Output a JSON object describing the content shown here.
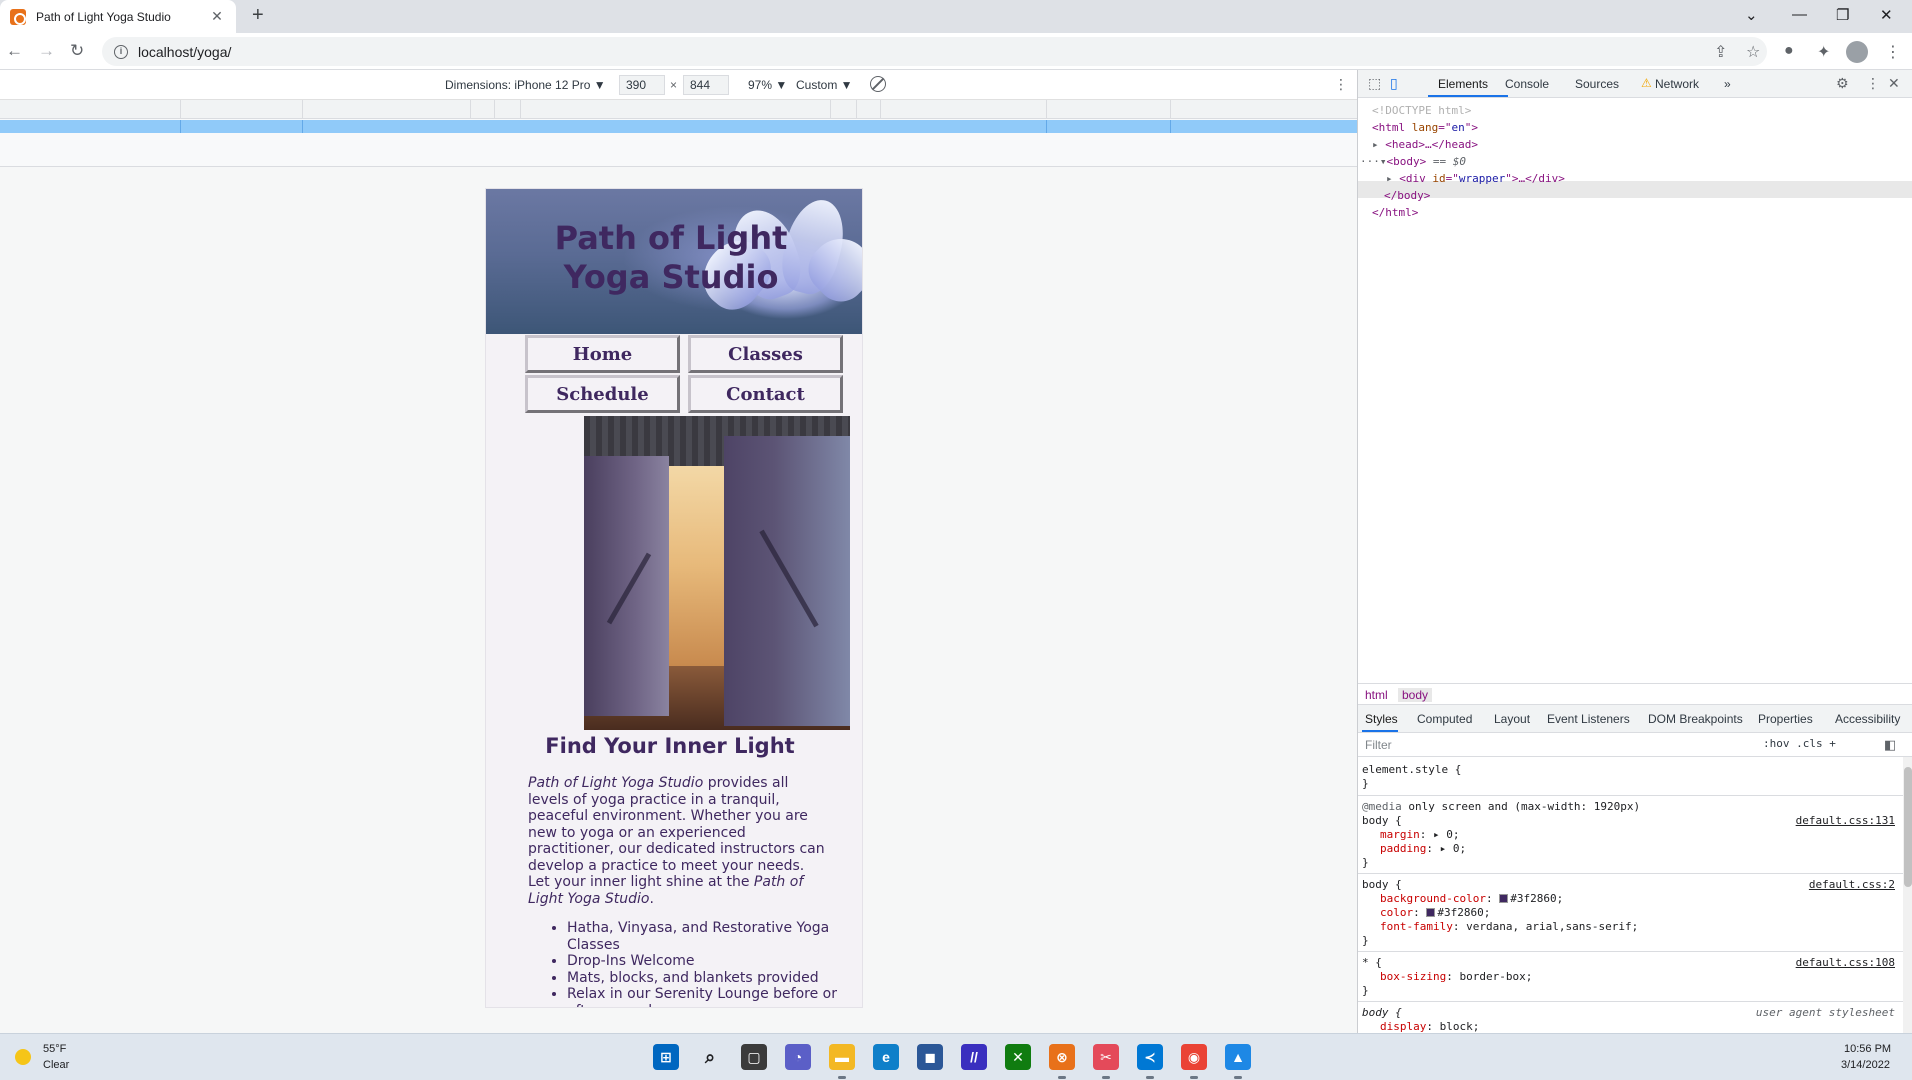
{
  "browser": {
    "tab_title": "Path of Light Yoga Studio",
    "url": "localhost/yoga/",
    "close_glyph": "✕",
    "new_tab_glyph": "+"
  },
  "device_toolbar": {
    "dimensions_label": "Dimensions: iPhone 12 Pro ▼",
    "width": "390",
    "height": "844",
    "times": "×",
    "zoom": "97% ▼",
    "throttle": "Custom ▼"
  },
  "site": {
    "title_line1": "Path of Light",
    "title_line2": "Yoga Studio",
    "nav": [
      "Home",
      "Classes",
      "Schedule",
      "Contact"
    ],
    "heading": "Find Your Inner Light",
    "intro_em1": "Path of Light Yoga Studio",
    "intro_text": " provides all levels of yoga practice in a tranquil, peaceful environment. Whether you are new to yoga or an experienced practitioner, our dedicated instructors can develop a practice to meet your needs. Let your inner light shine at the ",
    "intro_em2": "Path of Light Yoga Studio",
    "intro_end": ".",
    "features": [
      "Hatha, Vinyasa, and Restorative Yoga Classes",
      "Drop-Ins Welcome",
      "Mats, blocks, and blankets provided",
      "Relax in our Serenity Lounge before or after your class"
    ]
  },
  "devtools": {
    "tabs": [
      "Elements",
      "Console",
      "Sources",
      "Network"
    ],
    "more": "»",
    "dom": {
      "doctype": "<!DOCTYPE html>",
      "html_open_tag": "<html ",
      "html_attr_name": "lang",
      "html_attr_eq": "=\"",
      "html_attr_value": "en",
      "html_attr_close": "\">",
      "head": "<head>…</head>",
      "body_open": "<body>",
      "body_marker": " == $0",
      "div_open": "<div ",
      "div_attr_name": "id",
      "div_attr_value": "wrapper",
      "div_rest": "\">…</div>",
      "body_close": "</body>",
      "html_close": "</html>",
      "dots": "···"
    },
    "crumbs": [
      "html",
      "body"
    ],
    "style_tabs": [
      "Styles",
      "Computed",
      "Layout",
      "Event Listeners",
      "DOM Breakpoints",
      "Properties",
      "Accessibility"
    ],
    "filter_placeholder": "Filter",
    "filter_tools": ":hov  .cls  +",
    "css": {
      "element_style": "element.style {",
      "close_brace": "}",
      "media_at": "@media",
      "media_query": " only screen and (max-width: 1920px)",
      "body_sel": "body {",
      "src1": "default.css:131",
      "margin_prop": "margin",
      "margin_val": ": ▸ 0;",
      "padding_prop": "padding",
      "padding_val": ": ▸ 0;",
      "src2": "default.css:2",
      "bg_prop": "background-color",
      "bg_val": "#3f2860;",
      "color_prop": "color",
      "color_val": "#3f2860;",
      "font_prop": "font-family",
      "font_val": ": verdana, arial,sans-serif;",
      "star_sel": "* {",
      "src3": "default.css:108",
      "boxsizing_prop": "box-sizing",
      "boxsizing_val": ": border-box;",
      "ua_sel": "body {",
      "ua_src": "user agent stylesheet",
      "display_prop": "display",
      "display_val": ": block;"
    }
  },
  "taskbar": {
    "temp": "55°F",
    "condition": "Clear",
    "time": "10:56 PM",
    "date": "3/14/2022"
  },
  "colors": {
    "site_text": "#3f2860",
    "media_bar": "#90caf9",
    "devtools_accent": "#1a73e8"
  }
}
